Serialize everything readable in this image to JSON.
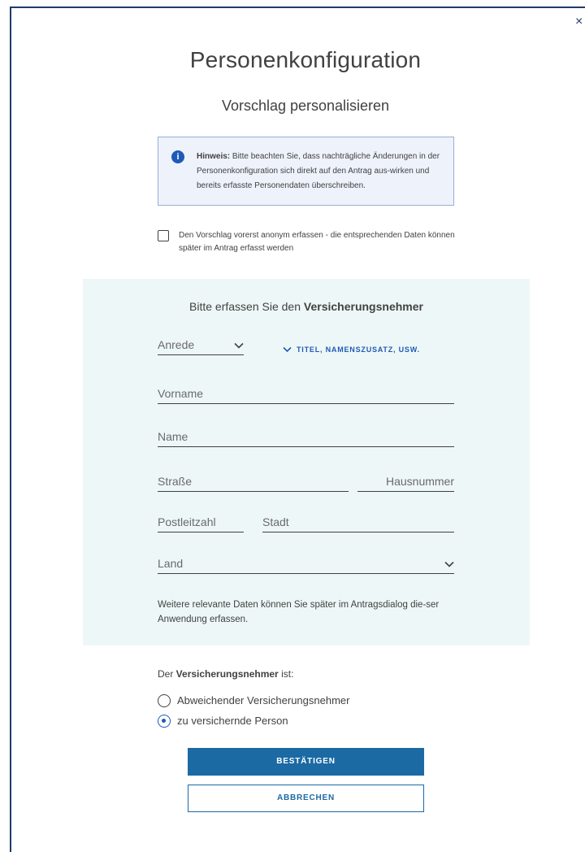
{
  "dialog": {
    "close_glyph": "×",
    "title": "Personenkonfiguration",
    "subtitle": "Vorschlag personalisieren"
  },
  "hint": {
    "icon": "info-icon",
    "bold": "Hinweis:",
    "text": " Bitte beachten Sie, dass nachträgliche Änderungen in der Personenkonfiguration sich direkt auf den Antrag aus-wirken und bereits erfasste Personendaten überschreiben."
  },
  "anonymous": {
    "checked": false,
    "label": "Den Vorschlag vorerst anonym erfassen - die entsprechenden Daten können später im Antrag erfasst werden"
  },
  "form": {
    "heading_prefix": "Bitte erfassen Sie den ",
    "heading_bold": "Versicherungsnehmer",
    "anrede": "Anrede",
    "titel_link": "TITEL, NAMENSZUSATZ, USW.",
    "vorname": "Vorname",
    "name": "Name",
    "strasse": "Straße",
    "hausnummer": "Hausnummer",
    "plz": "Postleitzahl",
    "stadt": "Stadt",
    "land": "Land",
    "note": "Weitere relevante Daten können Sie später im Antragsdialog die-ser Anwendung erfassen."
  },
  "vn": {
    "prefix": "Der ",
    "bold": "Versicherungsnehmer",
    "suffix": " ist:",
    "options": [
      {
        "label": "Abweichender Versicherungsnehmer",
        "selected": false
      },
      {
        "label": "zu versichernde Person",
        "selected": true
      }
    ]
  },
  "buttons": {
    "confirm": "BESTÄTIGEN",
    "cancel": "ABBRECHEN"
  },
  "colors": {
    "accent": "#1b6aa4",
    "panel": "#eef7f7",
    "hint_bg": "#eef2fb"
  }
}
